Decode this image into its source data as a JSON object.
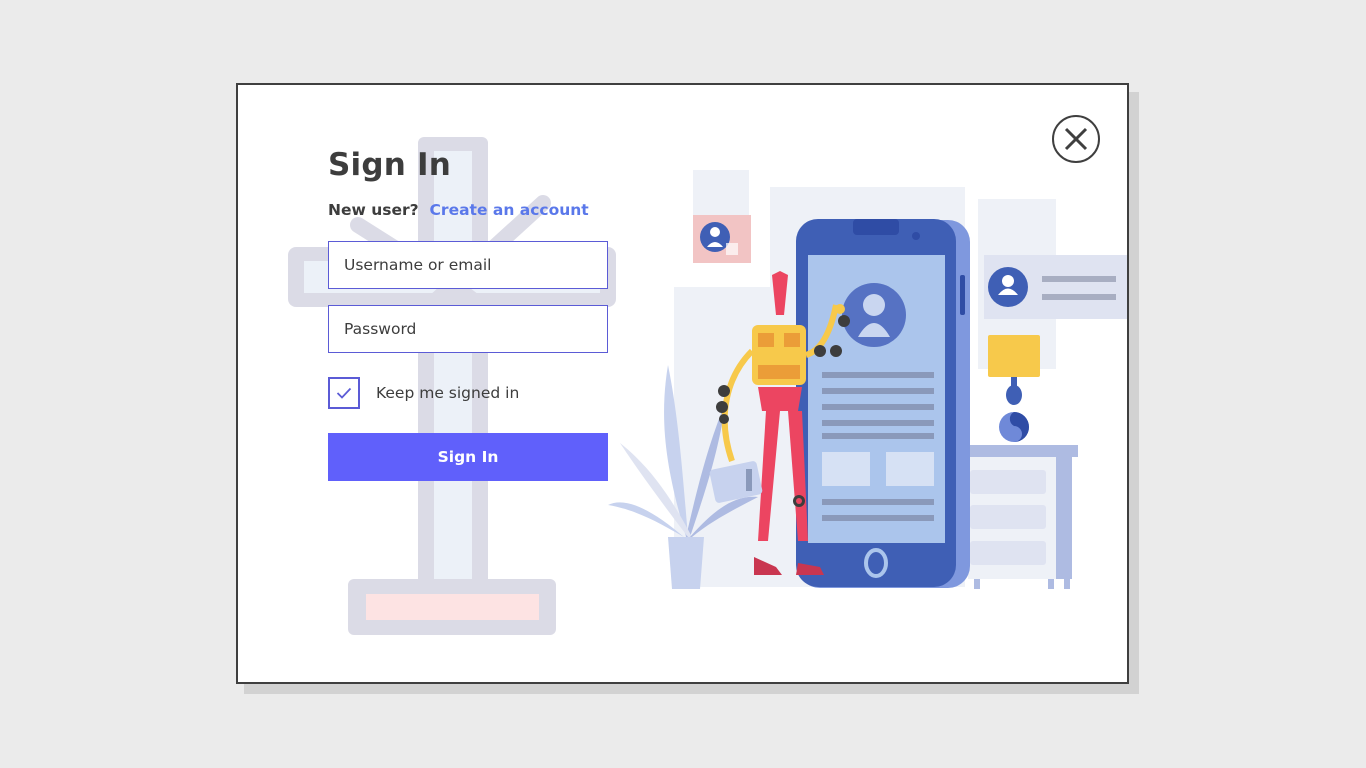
{
  "modal": {
    "title": "Sign In",
    "new_user_label": "New user?",
    "create_account_link": "Create an account",
    "username": {
      "placeholder": "Username or email",
      "value": ""
    },
    "password": {
      "placeholder": "Password",
      "value": ""
    },
    "keep_signed_in": {
      "label": "Keep me signed in",
      "checked": true
    },
    "submit_label": "Sign In",
    "close_icon": "close-icon"
  },
  "colors": {
    "accent": "#6060fb",
    "link": "#5a78ea",
    "text": "#3d3d3d",
    "border": "#5b5bd6",
    "page_background": "#ebebeb"
  },
  "icons": {
    "close": "close-icon",
    "checkbox": "checkmark-icon"
  }
}
